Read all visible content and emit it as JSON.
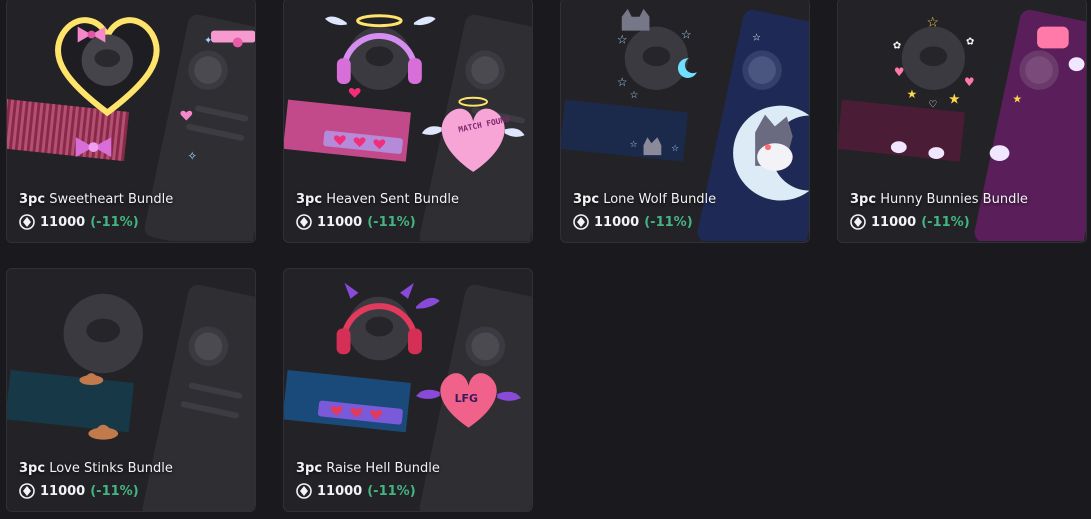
{
  "bundles": [
    {
      "qty": "3pc",
      "name": "Sweetheart Bundle",
      "price": "11000",
      "discount": "(-11%)",
      "accent": "#f06fb5",
      "banner": "#7a2240"
    },
    {
      "qty": "3pc",
      "name": "Heaven Sent Bundle",
      "price": "11000",
      "discount": "(-11%)",
      "accent": "#c586e8",
      "banner": "#b43b7c"
    },
    {
      "qty": "3pc",
      "name": "Lone Wolf Bundle",
      "price": "11000",
      "discount": "(-11%)",
      "accent": "#6fc8ff",
      "banner": "#1c2a55"
    },
    {
      "qty": "3pc",
      "name": "Hunny Bunnies Bundle",
      "price": "11000",
      "discount": "(-11%)",
      "accent": "#ff7aa8",
      "banner": "#5a1f4a"
    },
    {
      "qty": "3pc",
      "name": "Love Stinks Bundle",
      "price": "11000",
      "discount": "(-11%)",
      "accent": "#c27a4d",
      "banner": "#173846"
    },
    {
      "qty": "3pc",
      "name": "Raise Hell Bundle",
      "price": "11000",
      "discount": "(-11%)",
      "accent": "#e23a5c",
      "banner": "#1a4a7a"
    }
  ],
  "art_text": {
    "heaven_sent_heart": "MATCH FOUND",
    "raise_hell_heart": "LFG"
  },
  "colors": {
    "background": "#1a1a1e",
    "card": "#232327",
    "discount_green": "#43b581"
  }
}
